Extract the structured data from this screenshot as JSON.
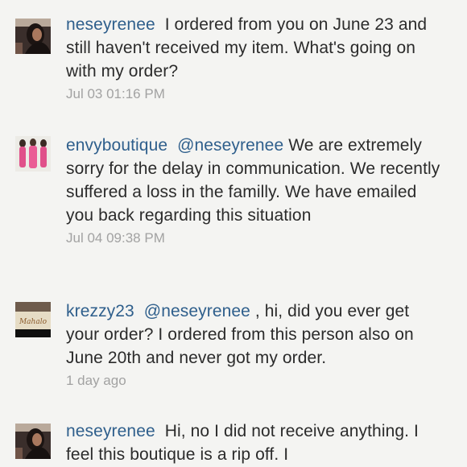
{
  "comments": [
    {
      "username": "neseyrenee",
      "mention": "",
      "text": "I ordered from you on June 23 and still haven't received my item. What's going on with my order?",
      "timestamp": "Jul 03 01:16 PM",
      "avatar_icon": "profile-photo-dark-hair"
    },
    {
      "username": "envyboutique",
      "mention": "@neseyrenee",
      "text": "We are extremely sorry for the delay in communication. We recently suffered a loss in the familly. We have emailed you back regarding this situation",
      "timestamp": "Jul 04 09:38 PM",
      "avatar_icon": "profile-photo-pink-outfits"
    },
    {
      "username": "krezzy23",
      "mention": "@neseyrenee",
      "text": ", hi, did you ever get your order? I ordered from this person also on June 20th and never got my order.",
      "timestamp": "1 day ago",
      "avatar_icon": "profile-photo-mahalo-sign",
      "avatar_text": "Mahalo"
    },
    {
      "username": "neseyrenee",
      "mention": "",
      "text": "Hi, no I did not receive anything. I feel this boutique is a rip off. I",
      "timestamp": "",
      "avatar_icon": "profile-photo-dark-hair"
    }
  ],
  "colors": {
    "username": "#2f5f8c",
    "text": "#2b2b2b",
    "timestamp": "#a2a2a2",
    "background": "#f4f4f2"
  }
}
